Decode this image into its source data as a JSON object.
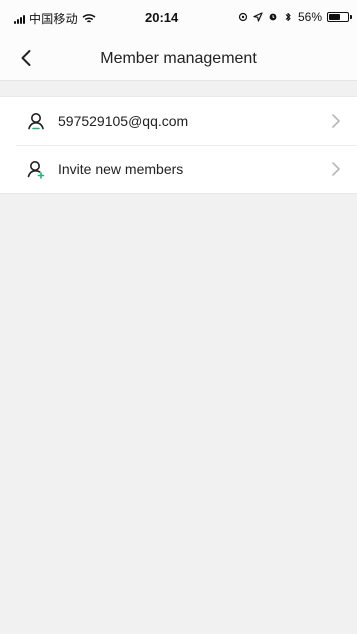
{
  "status_bar": {
    "carrier": "中国移动",
    "time": "20:14",
    "battery": "56%",
    "battery_level": 0.56
  },
  "nav": {
    "title": "Member management"
  },
  "list": {
    "items": [
      {
        "label": "597529105@qq.com",
        "icon": "user-icon",
        "accent": "#22b573"
      },
      {
        "label": "Invite new members",
        "icon": "user-add-icon",
        "accent": "#22b573"
      }
    ]
  }
}
